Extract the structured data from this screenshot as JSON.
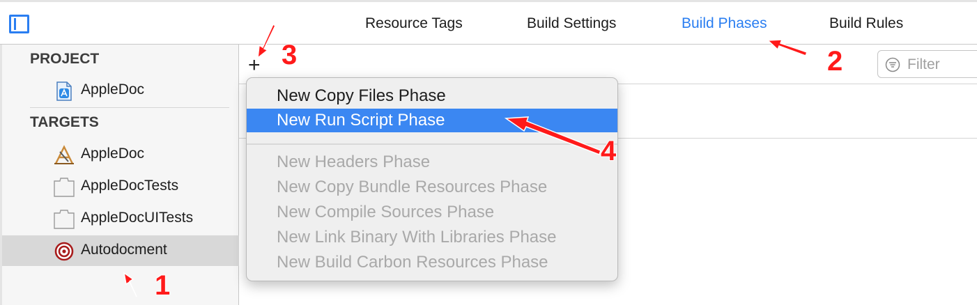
{
  "toolbar": {
    "tabs": [
      {
        "label": "Resource Tags",
        "active": false
      },
      {
        "label": "Build Settings",
        "active": false
      },
      {
        "label": "Build Phases",
        "active": true
      },
      {
        "label": "Build Rules",
        "active": false
      }
    ],
    "accent_color": "#2a7ef1"
  },
  "sidebar": {
    "project_header": "PROJECT",
    "project_items": [
      {
        "label": "AppleDoc",
        "icon": "app-project-icon"
      }
    ],
    "targets_header": "TARGETS",
    "target_items": [
      {
        "label": "AppleDoc",
        "icon": "app-target-icon",
        "selected": false
      },
      {
        "label": "AppleDocTests",
        "icon": "bundle-icon",
        "selected": false
      },
      {
        "label": "AppleDocUITests",
        "icon": "bundle-icon",
        "selected": false
      },
      {
        "label": "Autodocment",
        "icon": "aggregate-target-icon",
        "selected": true
      }
    ]
  },
  "content": {
    "add_button": "+",
    "filter_placeholder": "Filter"
  },
  "menu": {
    "items": [
      {
        "label": "New Copy Files Phase",
        "enabled": true,
        "highlighted": false
      },
      {
        "label": "New Run Script Phase",
        "enabled": true,
        "highlighted": true
      },
      {
        "label": "New Headers Phase",
        "enabled": false,
        "highlighted": false
      },
      {
        "label": "New Copy Bundle Resources Phase",
        "enabled": false,
        "highlighted": false
      },
      {
        "label": "New Compile Sources Phase",
        "enabled": false,
        "highlighted": false
      },
      {
        "label": "New Link Binary With Libraries Phase",
        "enabled": false,
        "highlighted": false
      },
      {
        "label": "New Build Carbon Resources Phase",
        "enabled": false,
        "highlighted": false
      }
    ],
    "highlight_color": "#3b87f2"
  },
  "annotations": {
    "numbers": [
      "1",
      "2",
      "3",
      "4"
    ],
    "color": "#ff1a1a"
  }
}
